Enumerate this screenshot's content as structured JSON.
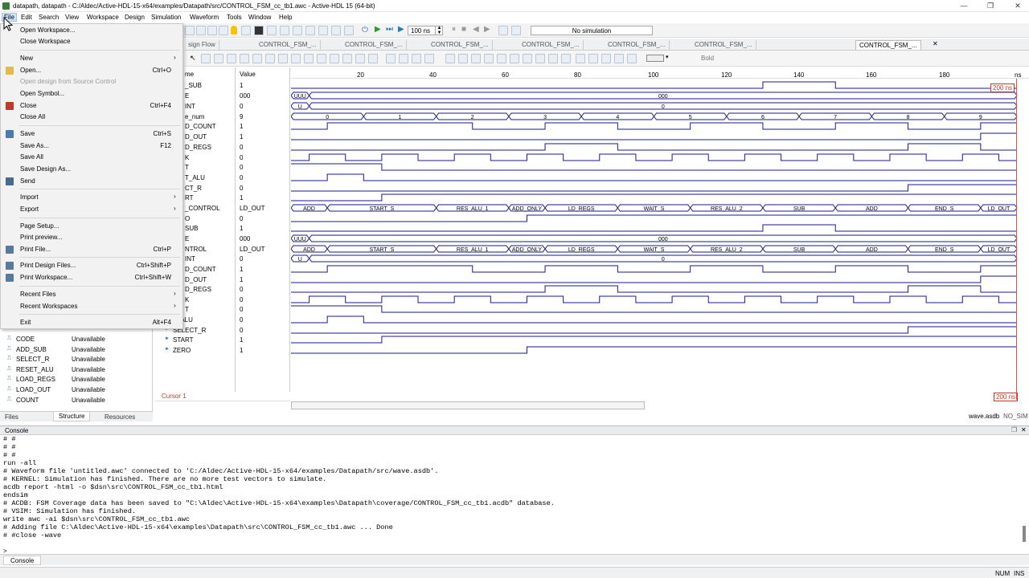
{
  "window": {
    "title": "datapath, datapath - C:/Aldec/Active-HDL-15-x64/examples/Datapath/src/CONTROL_FSM_cc_tb1.awc - Active-HDL 15 (64-bit)",
    "min": "—",
    "max": "❐",
    "close": "✕"
  },
  "menubar": [
    "File",
    "Edit",
    "Search",
    "View",
    "Workspace",
    "Design",
    "Simulation",
    "Waveform",
    "Tools",
    "Window",
    "Help"
  ],
  "toolbar": {
    "time_value": "100 ns",
    "sim_status": "No simulation"
  },
  "tabs": [
    "sign Flow",
    "CONTROL_FSM_...",
    "CONTROL_FSM_...",
    "CONTROL_FSM_...",
    "CONTROL_FSM_...",
    "CONTROL_FSM_...",
    "CONTROL_FSM_...",
    "CONTROL_FSM_..."
  ],
  "waveform_toolbar": {
    "bold_label": "Bold"
  },
  "waveform": {
    "col_name": "me",
    "col_value": "Value",
    "ruler": [
      "20",
      "40",
      "60",
      "80",
      "100",
      "120",
      "140",
      "160",
      "180",
      "ns"
    ],
    "signals": [
      {
        "name": "_SUB",
        "value": "1"
      },
      {
        "name": "E",
        "value": "000"
      },
      {
        "name": "INT",
        "value": "0"
      },
      {
        "name": "e_num",
        "value": "9"
      },
      {
        "name": "D_COUNT",
        "value": "1"
      },
      {
        "name": "D_OUT",
        "value": "1"
      },
      {
        "name": "D_REGS",
        "value": "0"
      },
      {
        "name": "K",
        "value": "0"
      },
      {
        "name": "T",
        "value": "0"
      },
      {
        "name": "T_ALU",
        "value": "0"
      },
      {
        "name": "CT_R",
        "value": "0"
      },
      {
        "name": "RT",
        "value": "1"
      },
      {
        "name": "_CONTROL",
        "value": "LD_OUT"
      },
      {
        "name": "O",
        "value": "0"
      },
      {
        "name": "SUB",
        "value": "1"
      },
      {
        "name": "E",
        "value": "000"
      },
      {
        "name": "NTROL",
        "value": "LD_OUT"
      },
      {
        "name": "INT",
        "value": "0"
      },
      {
        "name": "D_COUNT",
        "value": "1"
      },
      {
        "name": "D_OUT",
        "value": "1"
      },
      {
        "name": "D_REGS",
        "value": "0"
      },
      {
        "name": "K",
        "value": "0"
      },
      {
        "name": "T",
        "value": "0"
      },
      {
        "name": "T_ALU",
        "value": "0"
      },
      {
        "name": "SELECT_R",
        "value": "0"
      },
      {
        "name": "START",
        "value": "1"
      },
      {
        "name": "ZERO",
        "value": "1"
      }
    ],
    "bus_e_labels": [
      "UUU",
      "000"
    ],
    "bus_int_labels": [
      "U",
      "0"
    ],
    "state_num_labels": [
      "0",
      "1",
      "2",
      "3",
      "4",
      "5",
      "6",
      "7",
      "8",
      "9"
    ],
    "fsm_labels": [
      "ADD",
      "START_S",
      "RES_ALU_1",
      "ADD_ONLY",
      "LD_REGS",
      "WAIT_S",
      "RES_ALU_2",
      "SUB",
      "ADD",
      "END_S",
      "LD_OUT"
    ],
    "cursor_label": "Cursor 1",
    "marker_top": "200 ns",
    "marker_bottom": "200 ns"
  },
  "left_panel": {
    "rows": [
      {
        "name": "CODE",
        "status": "Unavailable"
      },
      {
        "name": "ADD_SUB",
        "status": "Unavailable"
      },
      {
        "name": "SELECT_R",
        "status": "Unavailable"
      },
      {
        "name": "RESET_ALU",
        "status": "Unavailable"
      },
      {
        "name": "LOAD_REGS",
        "status": "Unavailable"
      },
      {
        "name": "LOAD_OUT",
        "status": "Unavailable"
      },
      {
        "name": "COUNT",
        "status": "Unavailable"
      }
    ],
    "tabs": [
      "Files",
      "Structure",
      "Resources"
    ]
  },
  "file_menu": {
    "items": [
      {
        "label": "Open Workspace...",
        "shortcut": "",
        "disabled": false
      },
      {
        "label": "Close Workspace",
        "shortcut": "",
        "disabled": false
      },
      {
        "label": "New",
        "shortcut": "",
        "disabled": false,
        "submenu": true
      },
      {
        "label": "Open...",
        "shortcut": "Ctrl+O",
        "disabled": false
      },
      {
        "label": "Open design from Source Control",
        "shortcut": "",
        "disabled": true
      },
      {
        "label": "Open Symbol...",
        "shortcut": "",
        "disabled": false
      },
      {
        "label": "Close",
        "shortcut": "Ctrl+F4",
        "disabled": false
      },
      {
        "label": "Close All",
        "shortcut": "",
        "disabled": false
      },
      {
        "label": "Save",
        "shortcut": "Ctrl+S",
        "disabled": false
      },
      {
        "label": "Save As...",
        "shortcut": "F12",
        "disabled": false
      },
      {
        "label": "Save All",
        "shortcut": "",
        "disabled": false
      },
      {
        "label": "Save Design As...",
        "shortcut": "",
        "disabled": false
      },
      {
        "label": "Send",
        "shortcut": "",
        "disabled": false
      },
      {
        "label": "Import",
        "shortcut": "",
        "disabled": false,
        "submenu": true
      },
      {
        "label": "Export",
        "shortcut": "",
        "disabled": false,
        "submenu": true
      },
      {
        "label": "Page Setup...",
        "shortcut": "",
        "disabled": false
      },
      {
        "label": "Print preview...",
        "shortcut": "",
        "disabled": false
      },
      {
        "label": "Print File...",
        "shortcut": "Ctrl+P",
        "disabled": false
      },
      {
        "label": "Print Design Files...",
        "shortcut": "Ctrl+Shift+P",
        "disabled": false
      },
      {
        "label": "Print Workspace...",
        "shortcut": "Ctrl+Shift+W",
        "disabled": false
      },
      {
        "label": "Recent Files",
        "shortcut": "",
        "disabled": false,
        "submenu": true
      },
      {
        "label": "Recent Workspaces",
        "shortcut": "",
        "disabled": false,
        "submenu": true
      },
      {
        "label": "Exit",
        "shortcut": "Alt+F4",
        "disabled": false
      }
    ]
  },
  "console": {
    "title": "Console",
    "lines": [
      "# #",
      "# #",
      "# #",
      "run -all",
      "# Waveform file 'untitled.awc' connected to 'C:/Aldec/Active-HDL-15-x64/examples/Datapath/src/wave.asdb'.",
      "# KERNEL: Simulation has finished. There are no more test vectors to simulate.",
      "acdb report -html -o $dsn\\src\\CONTROL_FSM_cc_tb1.html",
      "endsim",
      "# ACDB: FSM Coverage data has been saved to \"C:\\Aldec\\Active-HDL-15-x64\\examples\\Datapath\\coverage/CONTROL_FSM_cc_tb1.acdb\" database.",
      "# VSIM: Simulation has finished.",
      "write awc -ai $dsn\\src\\CONTROL_FSM_cc_tb1.awc",
      "# Adding file C:\\Aldec\\Active-HDL-15-x64\\examples\\Datapath\\src\\CONTROL_FSM_cc_tb1.awc ... Done",
      "# #close -wave"
    ],
    "prompt": ">",
    "tab_label": "Console"
  },
  "status": {
    "wave_file": "wave.asdb",
    "sim": "NO_SIM",
    "num": "NUM",
    "ins": "INS"
  }
}
